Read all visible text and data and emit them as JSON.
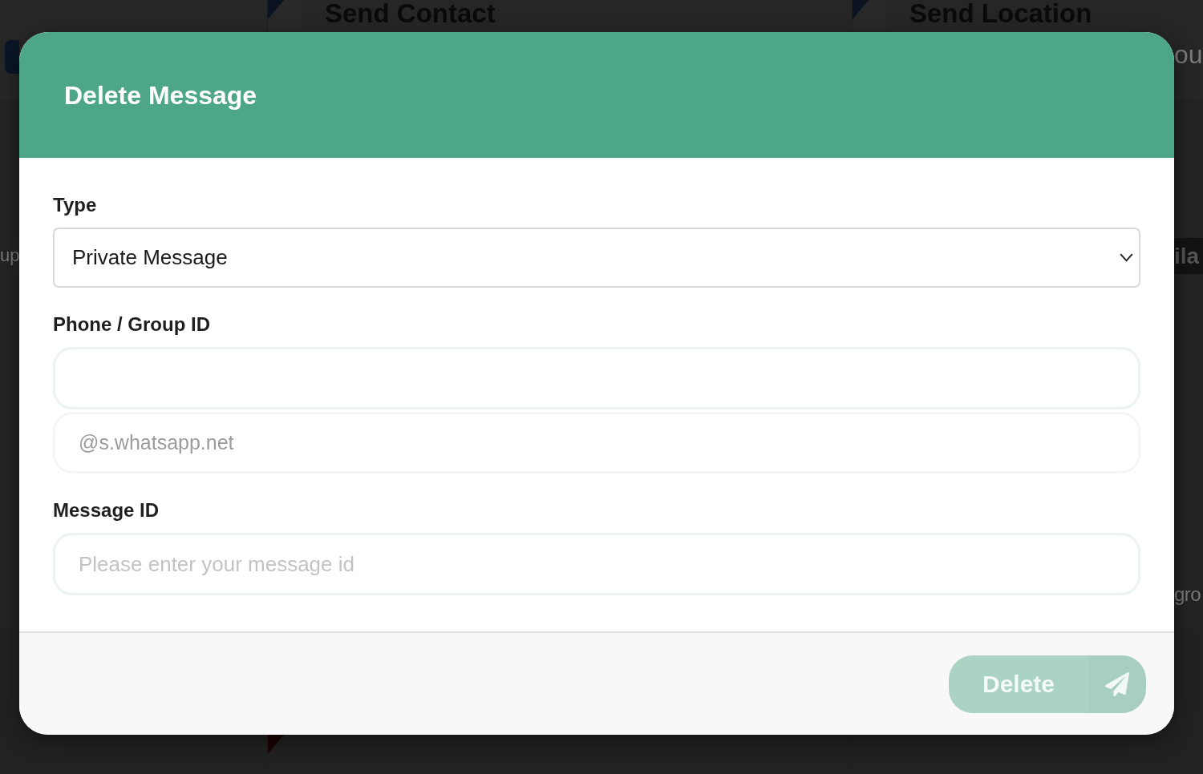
{
  "backdrop": {
    "sidebar": {
      "fragment": "up"
    },
    "cards": [
      {
        "title": "Send Contact"
      },
      {
        "title": "Send Location",
        "fragments": [
          "ou",
          "gro"
        ],
        "badge": "ila"
      }
    ]
  },
  "dialog": {
    "title": "Delete Message",
    "fields": [
      {
        "kind": "select",
        "label": "Type",
        "value": "Private Message"
      },
      {
        "kind": "input",
        "label": "Phone / Group ID",
        "suffix": "@s.whatsapp.net"
      },
      {
        "kind": "input",
        "label": "Message ID",
        "placeholder": "Please enter your message id"
      }
    ],
    "submit_button": {
      "label": "Delete",
      "disabled": true
    }
  }
}
